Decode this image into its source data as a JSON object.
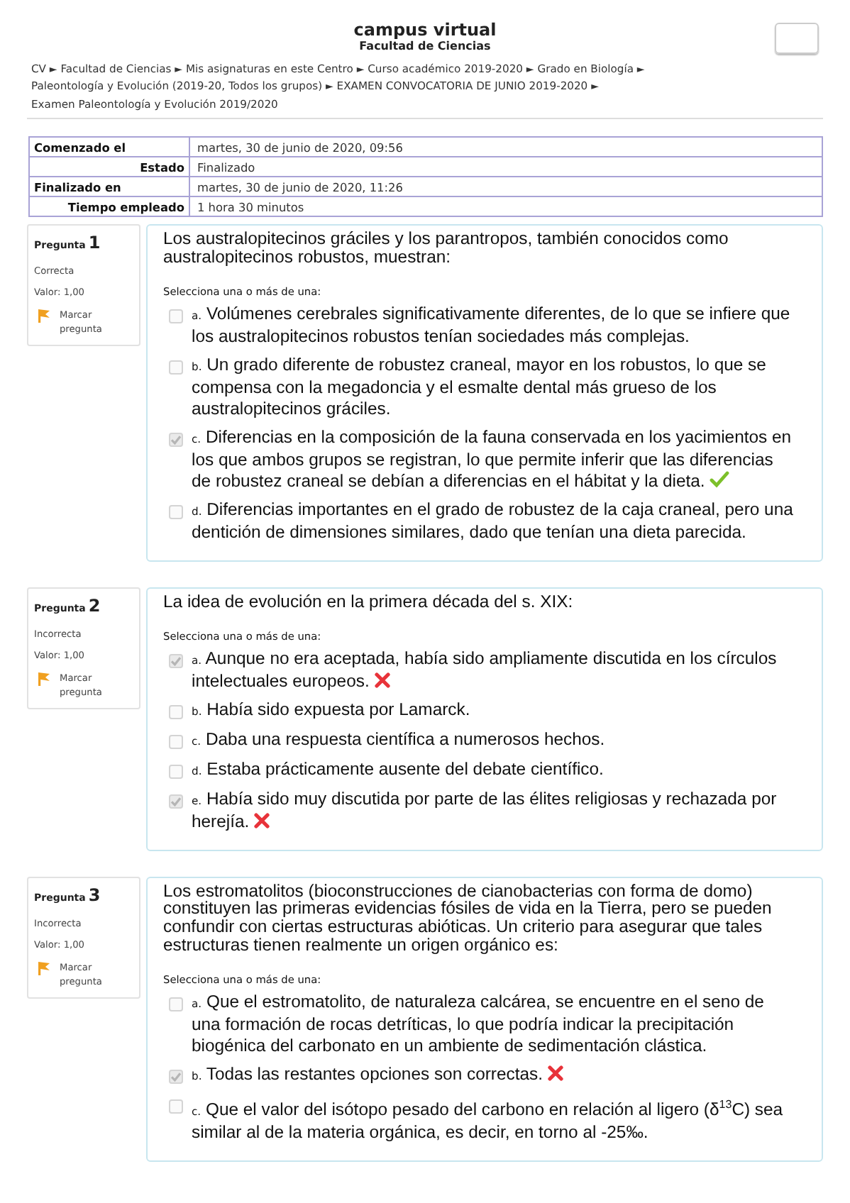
{
  "header": {
    "title": "campus virtual",
    "subtitle": "Facultad de Ciencias"
  },
  "breadcrumb": {
    "separator": "►",
    "items": [
      "CV",
      "Facultad de Ciencias",
      "Mis asignaturas en este Centro",
      "Curso académico 2019-2020",
      "Grado en Biología",
      "Paleontología y Evolución (2019-20, Todos los grupos)",
      "EXAMEN CONVOCATORIA DE JUNIO 2019-2020",
      "Examen Paleontología y Evolución 2019/2020"
    ]
  },
  "summary": [
    {
      "label": "Comenzado el",
      "value": "martes, 30 de junio de 2020, 09:56",
      "kind": "left"
    },
    {
      "label": "Estado",
      "value": "Finalizado",
      "kind": "right"
    },
    {
      "label": "Finalizado en",
      "value": "martes, 30 de junio de 2020, 11:26",
      "kind": "left"
    },
    {
      "label": "Tiempo empleado",
      "value": "1 hora 30 minutos",
      "kind": "right"
    }
  ],
  "questions": [
    {
      "label": "Pregunta",
      "number": "1",
      "status": "Correcta",
      "grade": "Valor: 1,00",
      "flag": "Marcar pregunta",
      "text": "Los australopitecinos gráciles y los parantropos, también conocidos como australopitecinos robustos, muestran:",
      "prompt": "Selecciona una o más de una:",
      "options": [
        {
          "letter": "a.",
          "text": "Volúmenes cerebrales significativamente diferentes, de lo que se infiere que los australopitecinos robustos tenían sociedades más complejas.",
          "checked": false,
          "kind": "plain"
        },
        {
          "letter": "b.",
          "text": "Un grado diferente de robustez craneal, mayor en los robustos, lo que se compensa con la megadoncia y el esmalte dental más grueso de los australopitecinos gráciles.",
          "checked": false,
          "kind": "plain"
        },
        {
          "letter": "c.",
          "text": "Diferencias en la composición de la fauna conservada en los yacimientos en los que ambos grupos se registran, lo que permite inferir que las diferencias de robustez craneal se debían a diferencias en el hábitat y la dieta.",
          "checked": true,
          "kind": "tick"
        },
        {
          "letter": "d.",
          "text": "Diferencias importantes en el grado de robustez de la caja craneal, pero una dentición de dimensiones similares, dado que tenían una dieta parecida.",
          "checked": false,
          "kind": "plain"
        }
      ]
    },
    {
      "label": "Pregunta",
      "number": "2",
      "status": "Incorrecta",
      "grade": "Valor: 1,00",
      "flag": "Marcar pregunta",
      "text": "La idea de evolución en la primera década del s. XIX:",
      "prompt": "Selecciona una o más de una:",
      "options": [
        {
          "letter": "a.",
          "text": "Aunque no era aceptada, había sido ampliamente discutida en los círculos intelectuales europeos.",
          "checked": true,
          "kind": "cross"
        },
        {
          "letter": "b.",
          "text": "Había sido expuesta por Lamarck.",
          "checked": false,
          "kind": "plain"
        },
        {
          "letter": "c.",
          "text": "Daba una respuesta científica a numerosos hechos.",
          "checked": false,
          "kind": "plain"
        },
        {
          "letter": "d.",
          "text": "Estaba prácticamente ausente del debate científico.",
          "checked": false,
          "kind": "plain"
        },
        {
          "letter": "e.",
          "text": "Había sido muy discutida por parte de las élites religiosas y rechazada por herejía.",
          "checked": true,
          "kind": "cross"
        }
      ]
    },
    {
      "label": "Pregunta",
      "number": "3",
      "status": "Incorrecta",
      "grade": "Valor: 1,00",
      "flag": "Marcar pregunta",
      "text": "Los estromatolitos (bioconstrucciones de cianobacterias con forma de domo) constituyen las primeras evidencias fósiles de vida en la Tierra, pero se pueden confundir con ciertas estructuras abióticas. Un criterio para asegurar que tales estructuras tienen realmente un origen orgánico es:",
      "prompt": "Selecciona una o más de una:",
      "options": [
        {
          "letter": "a.",
          "text": "Que el estromatolito, de naturaleza calcárea, se encuentre en el seno de una formación de rocas detríticas, lo que podría indicar la precipitación biogénica del carbonato en un ambiente de sedimentación clástica.",
          "checked": false,
          "kind": "plain"
        },
        {
          "letter": "b.",
          "text": "Todas las restantes opciones son correctas.",
          "checked": true,
          "kind": "cross"
        },
        {
          "letter": "c.",
          "text": "Que el valor del isótopo pesado del carbono en relación al ligero (δ$^{13}$C) sea similar al de la materia orgánica, es decir, en torno al -25‰.",
          "checked": false,
          "kind": "plain"
        }
      ]
    }
  ]
}
